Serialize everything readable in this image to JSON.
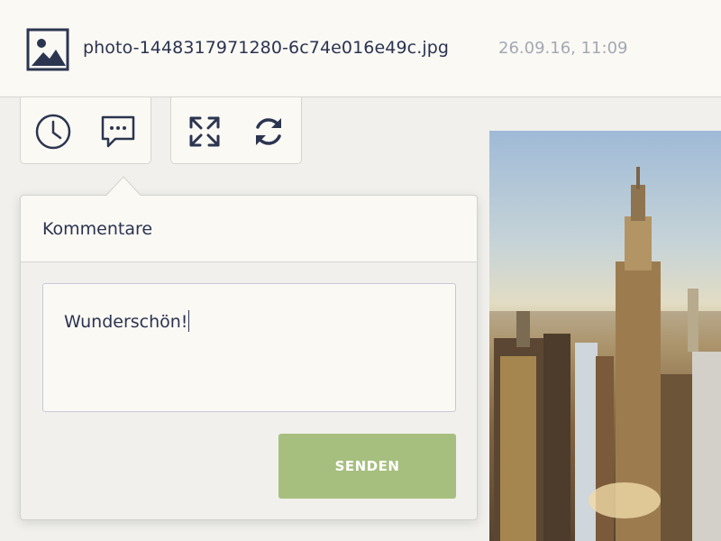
{
  "file": {
    "name": "photo-1448317971280-6c74e016e49c.jpg",
    "timestamp": "26.09.16, 11:09",
    "icon": "image-icon"
  },
  "toolbar": {
    "groups": [
      {
        "tools": [
          {
            "icon": "clock-icon"
          },
          {
            "icon": "comment-icon"
          }
        ]
      },
      {
        "tools": [
          {
            "icon": "fullscreen-icon"
          },
          {
            "icon": "refresh-icon"
          }
        ]
      }
    ]
  },
  "comments": {
    "title": "Kommentare",
    "input_value": "Wunderschön!",
    "send_label": "SENDEN"
  },
  "colors": {
    "accent_green": "#a7bf7e",
    "text_dark": "#2b3350",
    "text_muted": "#a3a8b4"
  }
}
